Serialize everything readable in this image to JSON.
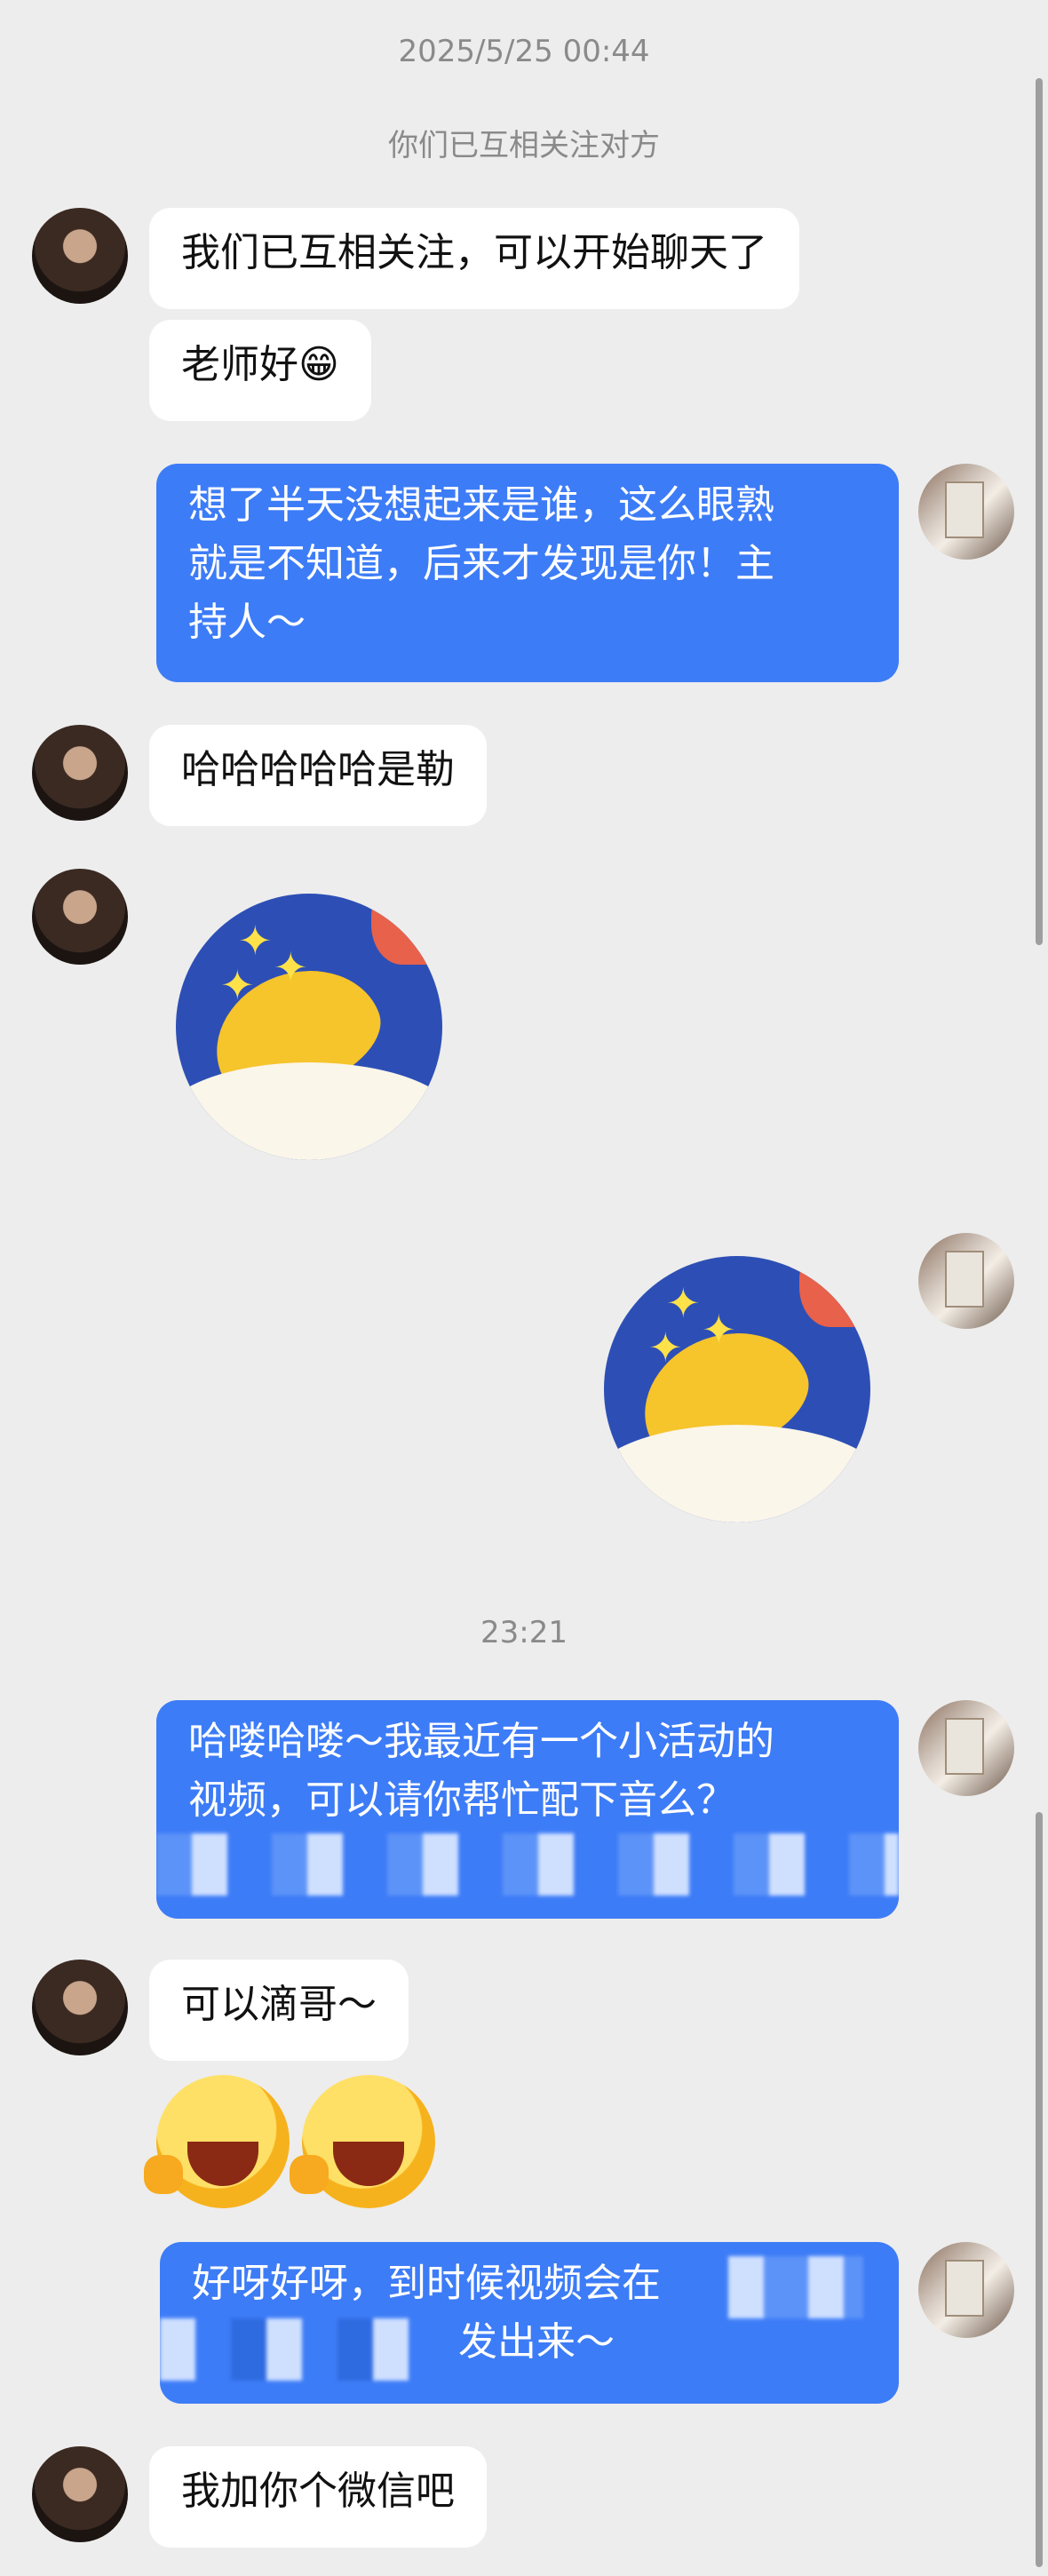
{
  "timestamps": {
    "top": "2025/5/25 00:44",
    "middle": "23:21"
  },
  "system_notice": "你们已互相关注对方",
  "messages": [
    {
      "from": "her",
      "text": "我们已互相关注，可以开始聊天了"
    },
    {
      "from": "her",
      "text": "老师好",
      "emoji": "😁"
    },
    {
      "from": "me",
      "lines": [
        "想了半天没想起来是谁，这么眼熟",
        "就是不知道，后来才发现是你！主",
        "持人～"
      ]
    },
    {
      "from": "her",
      "text": "哈哈哈哈哈是勒"
    },
    {
      "from": "her",
      "sticker": "sleeping-moon-sticker"
    },
    {
      "from": "me",
      "sticker": "sleeping-moon-sticker"
    },
    {
      "from": "me",
      "lines": [
        "哈喽哈喽～我最近有一个小活动的",
        "视频，可以请你帮忙配下音么？"
      ]
    },
    {
      "from": "her",
      "text": "可以滴哥～"
    },
    {
      "from": "her",
      "sticker": "winking-laughing-emoji-pair"
    },
    {
      "from": "me",
      "lines": [
        "好呀好呀，到时候视频会在",
        "发出来～"
      ]
    },
    {
      "from": "her",
      "text": "我加你个微信吧"
    }
  ],
  "colors": {
    "background": "#ededed",
    "bubble_in": "#ffffff",
    "bubble_out": "#3d7cf7"
  }
}
